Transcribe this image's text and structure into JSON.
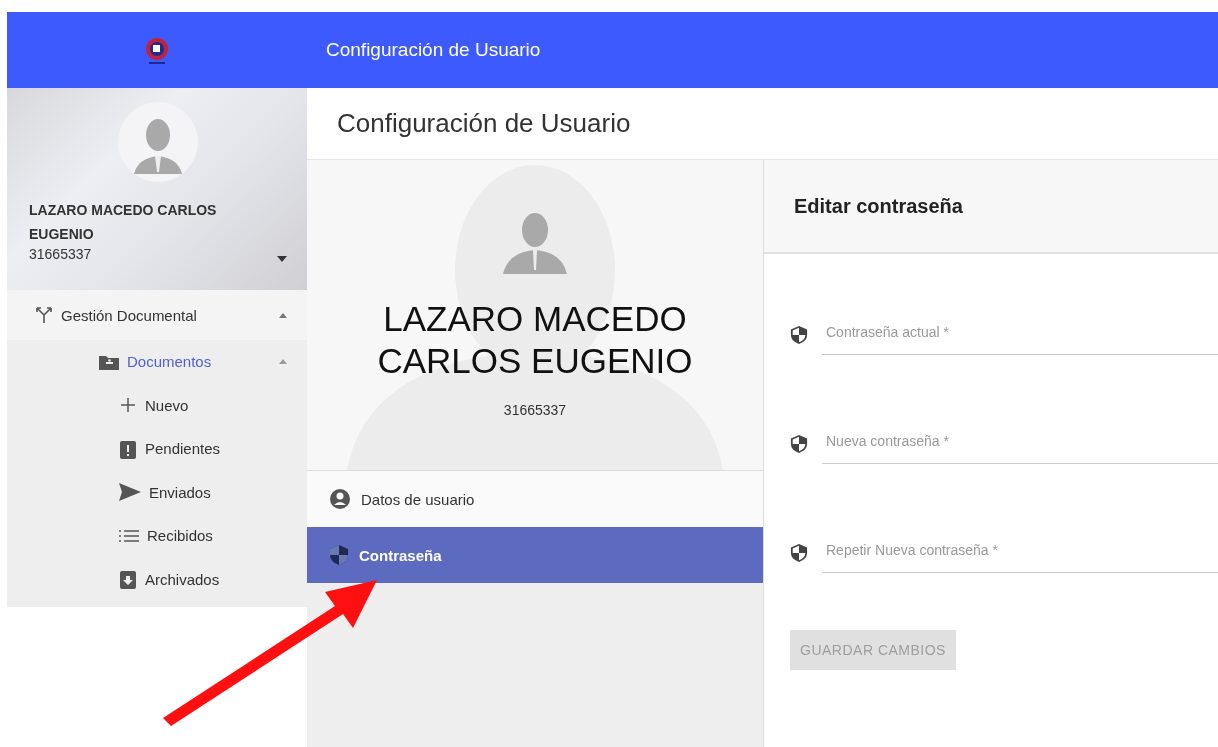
{
  "header": {
    "title": "Configuración de Usuario"
  },
  "sidebar": {
    "user": {
      "name": "LAZARO MACEDO CARLOS EUGENIO",
      "id": "31665337",
      "expanded": false
    },
    "menu": [
      {
        "label": "Gestión Documental",
        "kind": "fork",
        "expanded": true,
        "selected": false,
        "children": [
          {
            "label": "Documentos",
            "kind": "folder",
            "expanded": true,
            "selected": true,
            "children": [
              {
                "label": "Nuevo",
                "kind": "plus",
                "selected": false
              },
              {
                "label": "Pendientes",
                "kind": "alert",
                "selected": false
              },
              {
                "label": "Enviados",
                "kind": "send",
                "selected": false
              },
              {
                "label": "Recibidos",
                "kind": "list",
                "selected": false
              },
              {
                "label": "Archivados",
                "kind": "archive",
                "selected": false
              }
            ]
          }
        ]
      }
    ]
  },
  "page": {
    "title": "Configuración de Usuario"
  },
  "profile": {
    "name": "LAZARO MACEDO CARLOS EUGENIO",
    "id": "31665337",
    "menu": [
      {
        "label": "Datos de usuario",
        "kind": "account",
        "selected": false
      },
      {
        "label": "Contraseña",
        "kind": "shield",
        "selected": true
      }
    ]
  },
  "form": {
    "title": "Editar contraseña",
    "fields": [
      {
        "placeholder": "Contraseña actual *"
      },
      {
        "placeholder": "Nueva contraseña *"
      },
      {
        "placeholder": "Repetir Nueva contraseña *"
      }
    ],
    "submit": {
      "label": "GUARDAR CAMBIOS",
      "disabled": true
    }
  }
}
